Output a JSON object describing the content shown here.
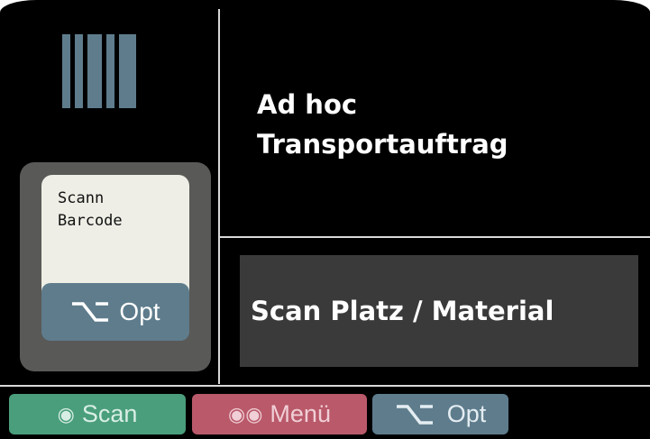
{
  "scan_widget": {
    "line1": "Scann",
    "line2": "Barcode",
    "opt_label": "Opt"
  },
  "header": {
    "title_line1": "Ad hoc",
    "title_line2": "Transportauftrag"
  },
  "status": {
    "text": "Scan Platz / Material"
  },
  "bottom_bar": {
    "scan_icon": "◉",
    "scan_label": "Scan",
    "menu_icon": "◉◉",
    "menu_label": "Menü",
    "opt_label": "Opt"
  },
  "colors": {
    "accent_blue": "#5e7c8c",
    "scan_green": "#4a9e7c",
    "menu_red": "#b9596a",
    "panel_gray": "#3a3a3a"
  },
  "icons": {
    "barcode": "barcode-icon",
    "option": "option-key-icon"
  }
}
